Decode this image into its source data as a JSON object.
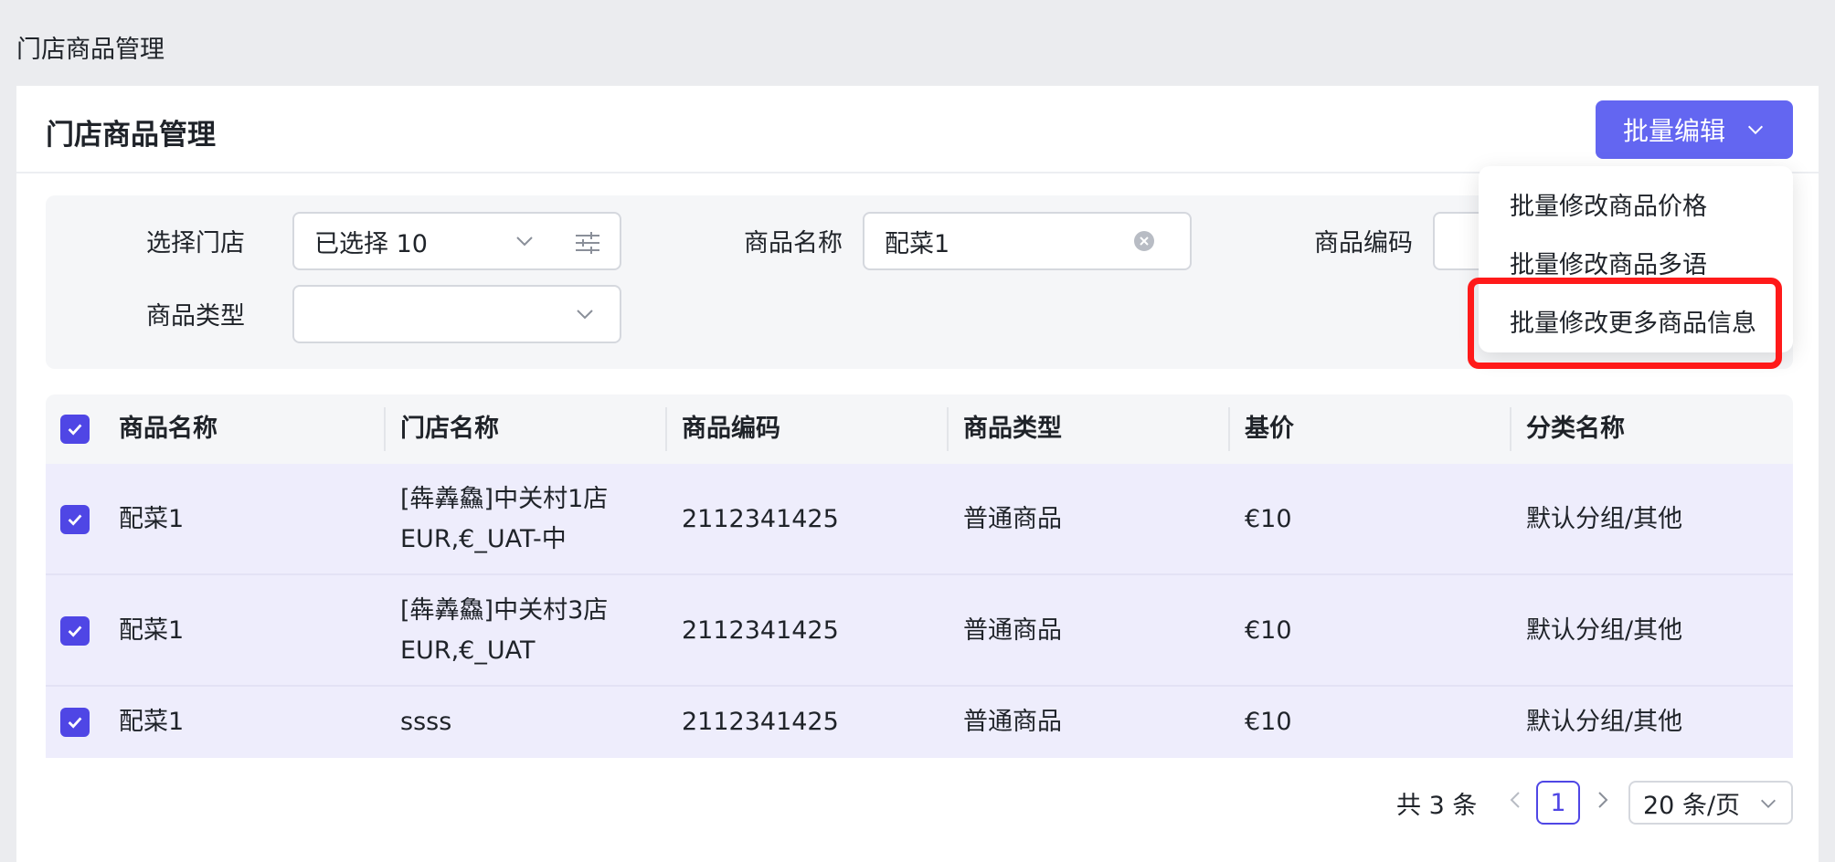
{
  "breadcrumb": "门店商品管理",
  "card": {
    "title": "门店商品管理",
    "batch_button": "批量编辑"
  },
  "dropdown": {
    "items": [
      "批量修改商品价格",
      "批量修改商品多语",
      "批量修改更多商品信息"
    ],
    "highlight_color": "#ff1a1a"
  },
  "filters": {
    "store_label": "选择门店",
    "store_value": "已选择 10",
    "name_label": "商品名称",
    "name_value": "配菜1",
    "code_label": "商品编码",
    "code_value": "",
    "type_label": "商品类型",
    "type_value": ""
  },
  "table": {
    "columns": [
      "商品名称",
      "门店名称",
      "商品编码",
      "商品类型",
      "基价",
      "分类名称"
    ],
    "rows": [
      {
        "name": "配菜1",
        "store_line1": "[犇羴鱻]中关村1店",
        "store_line2": "EUR,€_UAT-中",
        "code": "2112341425",
        "type": "普通商品",
        "price": "€10",
        "category": "默认分组/其他"
      },
      {
        "name": "配菜1",
        "store_line1": "[犇羴鱻]中关村3店",
        "store_line2": "EUR,€_UAT",
        "code": "2112341425",
        "type": "普通商品",
        "price": "€10",
        "category": "默认分组/其他"
      },
      {
        "name": "配菜1",
        "store_line1": "ssss",
        "store_line2": "",
        "code": "2112341425",
        "type": "普通商品",
        "price": "€10",
        "category": "默认分组/其他"
      }
    ]
  },
  "pagination": {
    "total": "共 3 条",
    "current_page": "1",
    "page_size": "20 条/页"
  },
  "colors": {
    "accent": "#6366f1",
    "checkbox": "#4f46e5",
    "selected_row": "#eeedfc"
  },
  "icons": [
    "chevron-down-icon",
    "filter-settings-icon",
    "clear-icon",
    "check-icon",
    "chevron-left-icon",
    "chevron-right-icon"
  ]
}
